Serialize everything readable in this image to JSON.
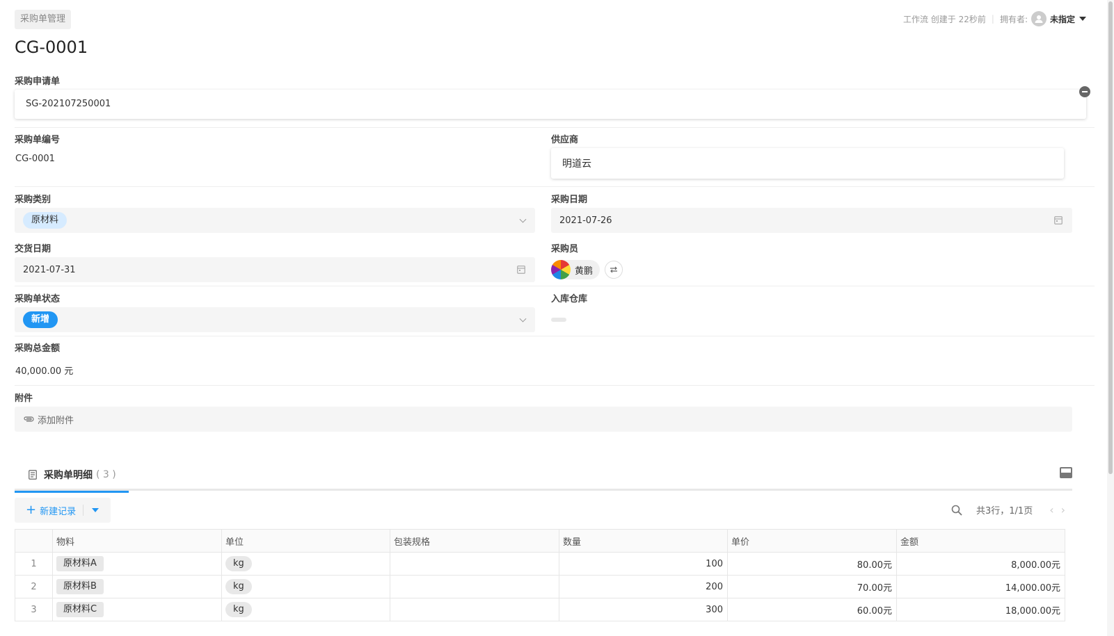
{
  "header": {
    "breadcrumb": "采购单管理",
    "meta_created": "工作流 创建于 22秒前",
    "owner_label": "拥有者:",
    "owner_name": "未指定"
  },
  "record": {
    "title": "CG-0001"
  },
  "fields": {
    "purchase_request": {
      "label": "采购申请单",
      "value": "SG-202107250001"
    },
    "order_no": {
      "label": "采购单编号",
      "value": "CG-0001"
    },
    "supplier": {
      "label": "供应商",
      "value": "明道云"
    },
    "category": {
      "label": "采购类别",
      "value": "原材料"
    },
    "purchase_date": {
      "label": "采购日期",
      "value": "2021-07-26"
    },
    "delivery_date": {
      "label": "交货日期",
      "value": "2021-07-31"
    },
    "buyer": {
      "label": "采购员",
      "value": "黄鹏"
    },
    "status": {
      "label": "采购单状态",
      "value": "新增"
    },
    "warehouse": {
      "label": "入库仓库"
    },
    "total": {
      "label": "采购总金额",
      "value": "40,000.00 元"
    },
    "attachment": {
      "label": "附件",
      "action": "添加附件"
    }
  },
  "detail": {
    "tab_label": "采购单明细",
    "tab_count": "( 3 )",
    "new_record": "新建记录",
    "pager_text": "共3行，1/1页",
    "columns": [
      "物料",
      "单位",
      "包装规格",
      "数量",
      "单价",
      "金额"
    ],
    "rows": [
      {
        "index": "1",
        "material": "原材料A",
        "unit": "kg",
        "spec": "",
        "qty": "100",
        "price": "80.00元",
        "amount": "8,000.00元"
      },
      {
        "index": "2",
        "material": "原材料B",
        "unit": "kg",
        "spec": "",
        "qty": "200",
        "price": "70.00元",
        "amount": "14,000.00元"
      },
      {
        "index": "3",
        "material": "原材料C",
        "unit": "kg",
        "spec": "",
        "qty": "300",
        "price": "60.00元",
        "amount": "18,000.00元"
      }
    ]
  }
}
